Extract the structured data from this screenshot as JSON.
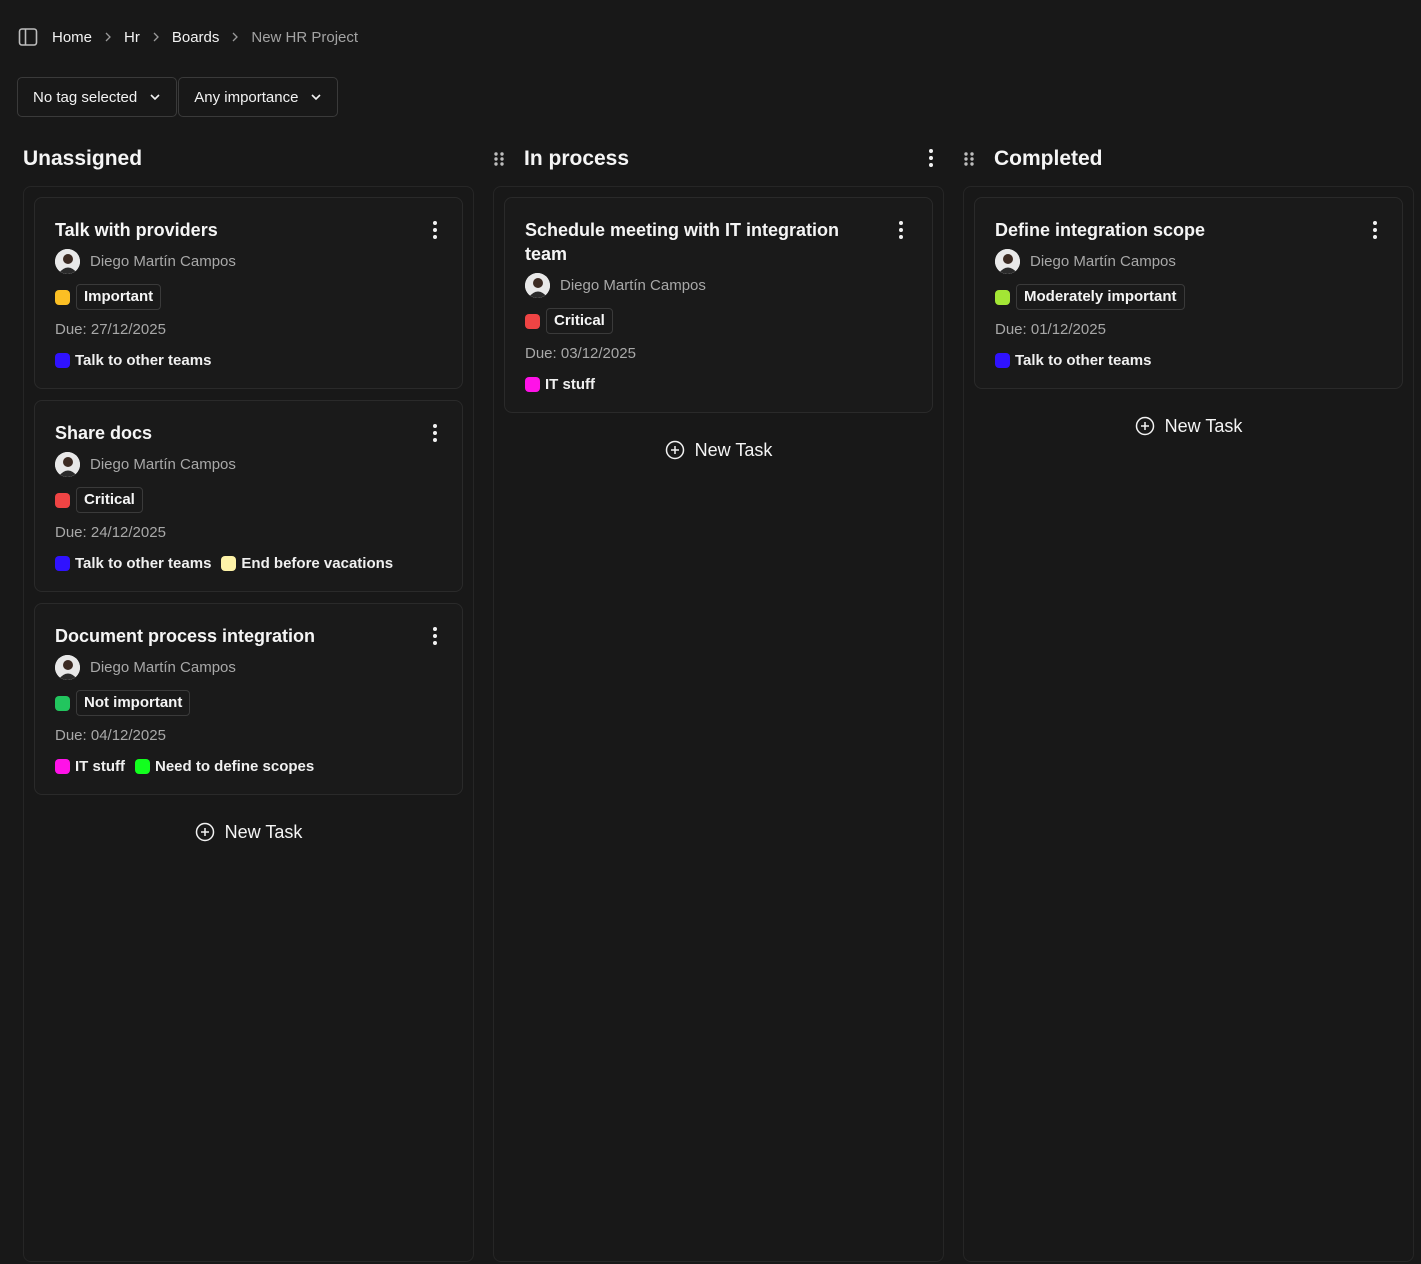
{
  "breadcrumb": {
    "items": [
      "Home",
      "Hr",
      "Boards"
    ],
    "current": "New HR Project"
  },
  "filters": {
    "tag_label": "No tag selected",
    "importance_label": "Any importance"
  },
  "columns": [
    {
      "title": "Unassigned",
      "new_task_label": "New Task",
      "cards": [
        {
          "title": "Talk with providers",
          "assignee": "Diego Martín Campos",
          "importance": "Important",
          "importance_color": "#fbbf24",
          "due": "Due: 27/12/2025",
          "tags": [
            {
              "label": "Talk to other teams",
              "color": "#2f12ff"
            }
          ]
        },
        {
          "title": "Share docs",
          "assignee": "Diego Martín Campos",
          "importance": "Critical",
          "importance_color": "#ef4444",
          "due": "Due: 24/12/2025",
          "tags": [
            {
              "label": "Talk to other teams",
              "color": "#2f12ff"
            },
            {
              "label": "End before vacations",
              "color": "#fef3a8"
            }
          ]
        },
        {
          "title": "Document process integration",
          "assignee": "Diego Martín Campos",
          "importance": "Not important",
          "importance_color": "#22c55e",
          "due": "Due: 04/12/2025",
          "tags": [
            {
              "label": "IT stuff",
              "color": "#ff12e8"
            },
            {
              "label": "Need to define scopes",
              "color": "#12ff1e"
            }
          ]
        }
      ]
    },
    {
      "title": "In process",
      "new_task_label": "New Task",
      "cards": [
        {
          "title": "Schedule meeting with IT integration team",
          "assignee": "Diego Martín Campos",
          "importance": "Critical",
          "importance_color": "#ef4444",
          "due": "Due: 03/12/2025",
          "tags": [
            {
              "label": "IT stuff",
              "color": "#ff12e8"
            }
          ]
        }
      ]
    },
    {
      "title": "Completed",
      "new_task_label": "New Task",
      "cards": [
        {
          "title": "Define integration scope",
          "assignee": "Diego Martín Campos",
          "importance": "Moderately important",
          "importance_color": "#a3e635",
          "due": "Due: 01/12/2025",
          "tags": [
            {
              "label": "Talk to other teams",
              "color": "#2f12ff"
            }
          ]
        }
      ]
    }
  ]
}
